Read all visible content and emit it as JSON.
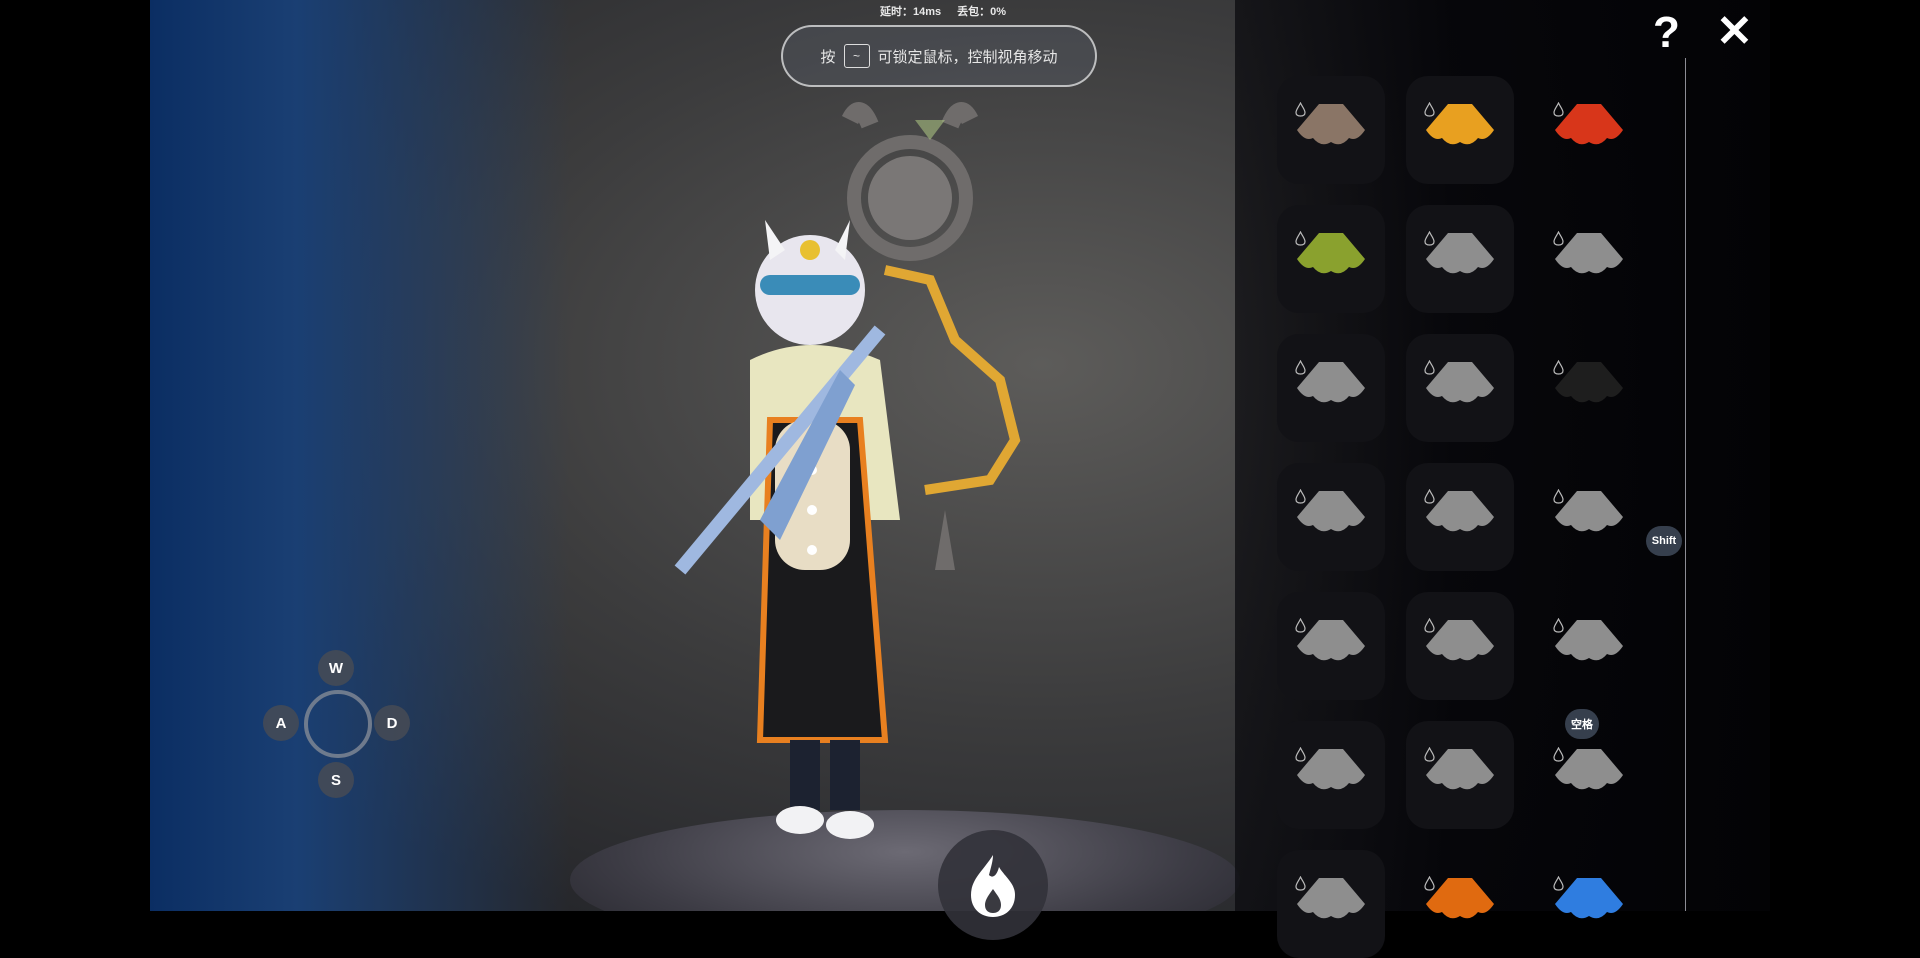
{
  "status": {
    "latency": "延时：14ms",
    "packet_loss": "丢包：0%"
  },
  "hint": {
    "prefix": "按",
    "key": "~",
    "text": "可锁定鼠标，控制视角移动"
  },
  "controls": {
    "w": "W",
    "a": "A",
    "s": "S",
    "d": "D",
    "shift": "Shift",
    "space": "空格"
  },
  "top_buttons": {
    "help": "?",
    "close": "✕"
  },
  "wardrobe": {
    "rows": [
      [
        {
          "color": "#8a7566",
          "framed": true
        },
        {
          "color": "#e8a020",
          "framed": true
        },
        {
          "color": "#d8361a",
          "framed": false
        }
      ],
      [
        {
          "color": "#8aa12e",
          "framed": true
        },
        {
          "color": "#8e8e8e",
          "framed": true
        },
        {
          "color": "#8e8e8e",
          "framed": false
        }
      ],
      [
        {
          "color": "#8e8e8e",
          "framed": true
        },
        {
          "color": "#8e8e8e",
          "framed": true
        },
        {
          "color": "#1e1e1e",
          "framed": false
        }
      ],
      [
        {
          "color": "#8e8e8e",
          "framed": true
        },
        {
          "color": "#8e8e8e",
          "framed": true
        },
        {
          "color": "#8e8e8e",
          "framed": false
        }
      ],
      [
        {
          "color": "#8e8e8e",
          "framed": true
        },
        {
          "color": "#8e8e8e",
          "framed": true
        },
        {
          "color": "#8e8e8e",
          "framed": false
        }
      ],
      [
        {
          "color": "#8e8e8e",
          "framed": true
        },
        {
          "color": "#8e8e8e",
          "framed": true
        },
        {
          "color": "#8e8e8e",
          "framed": false
        }
      ],
      [
        {
          "color": "#8e8e8e",
          "framed": true
        },
        {
          "color": "#e06a10",
          "framed": false
        },
        {
          "color": "#2f7de0",
          "framed": false
        }
      ]
    ]
  }
}
